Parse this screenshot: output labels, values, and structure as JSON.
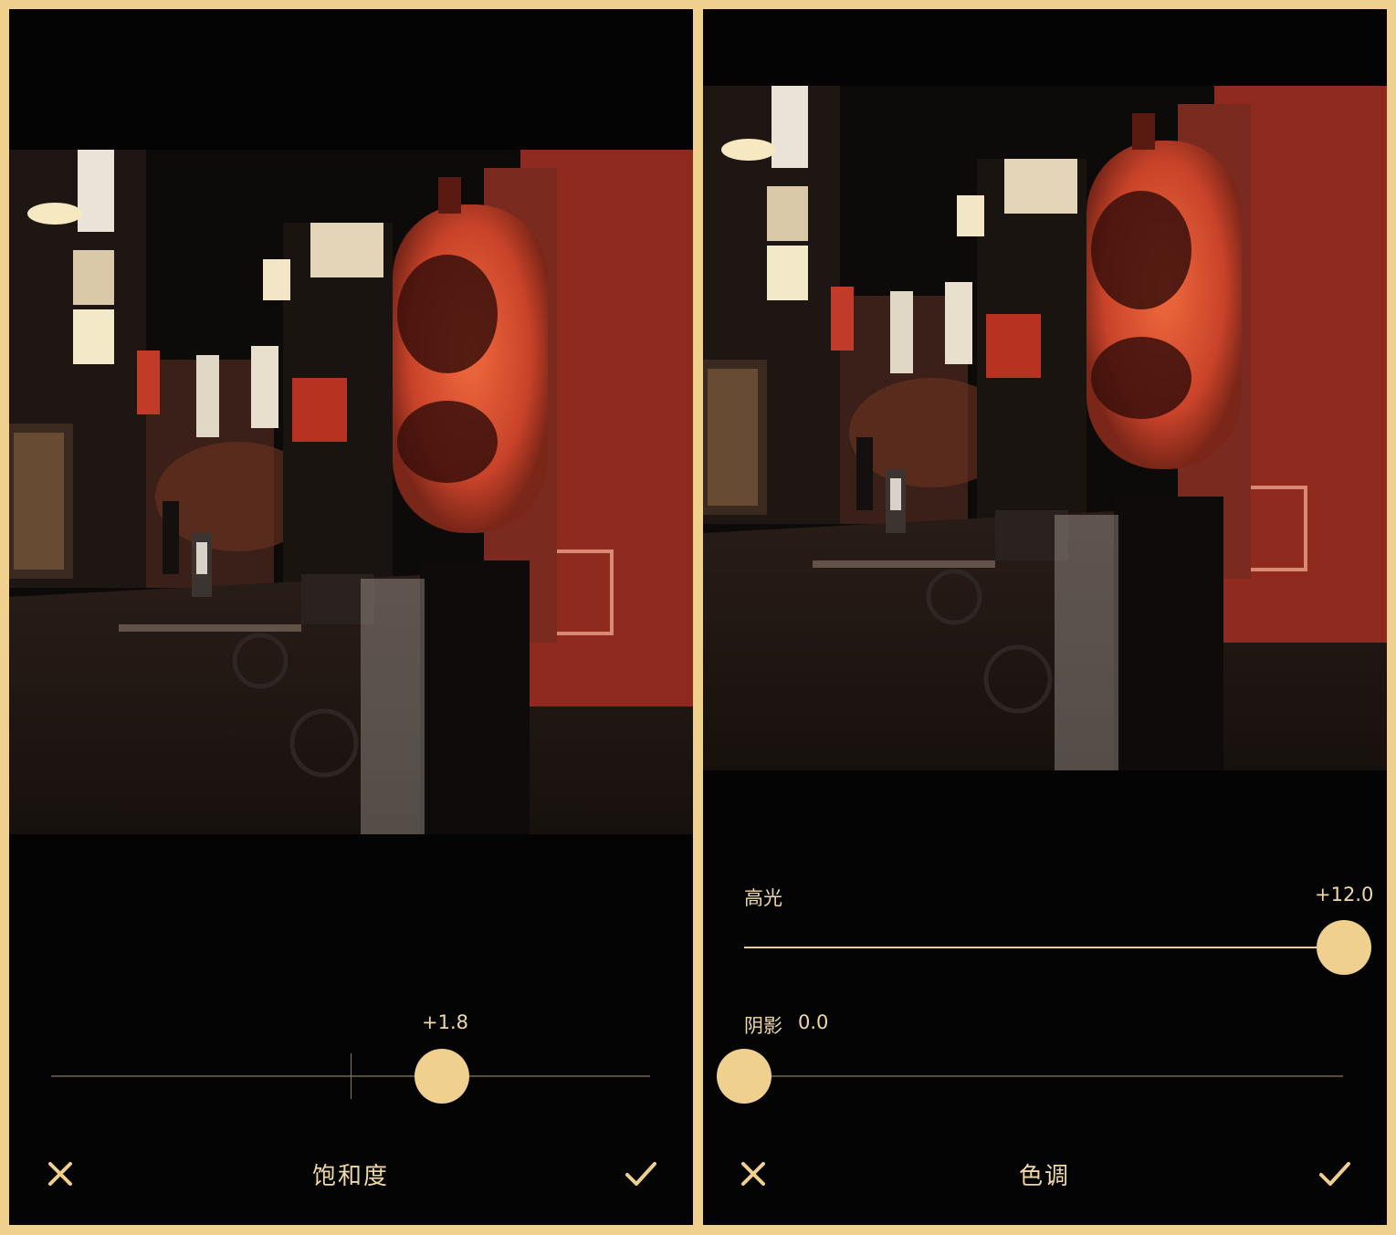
{
  "left_panel": {
    "tool_title": "饱和度",
    "slider": {
      "value_text": "+1.8",
      "value": 1.8
    },
    "cancel_icon": "close-icon",
    "confirm_icon": "check-icon"
  },
  "right_panel": {
    "tool_title": "色调",
    "sliders": [
      {
        "label": "高光",
        "value_text": "+12.0",
        "value": 12.0
      },
      {
        "label": "阴影",
        "value_text": "0.0",
        "value": 0.0
      }
    ],
    "cancel_icon": "close-icon",
    "confirm_icon": "check-icon"
  },
  "colors": {
    "accent": "#f0d08e",
    "background": "#040404",
    "frame": "#efd08e",
    "text": "#efd9a6"
  }
}
